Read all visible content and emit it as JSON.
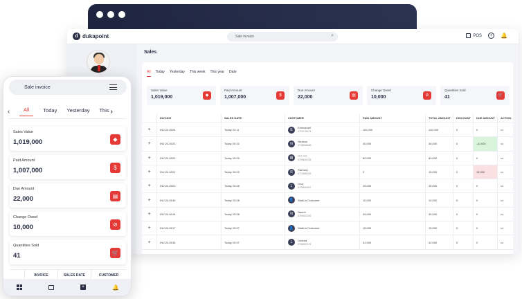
{
  "app": {
    "brand": "dukapoint",
    "logo_letter": "d"
  },
  "topbar": {
    "search_placeholder": "Sale invoice",
    "pos_label": "POS"
  },
  "page": {
    "title": "Sales"
  },
  "tabs": [
    "All",
    "Today",
    "Yesterday",
    "This week",
    "This year",
    "Date"
  ],
  "cards": [
    {
      "label": "Sales Value",
      "value": "1,019,000",
      "icon": "tag-icon"
    },
    {
      "label": "Paid Amount",
      "value": "1,007,000",
      "icon": "money-icon"
    },
    {
      "label": "Due Amount",
      "value": "22,000",
      "icon": "invoice-icon"
    },
    {
      "label": "Change Owed",
      "value": "10,000",
      "icon": "change-icon"
    },
    {
      "label": "Quantities Sold",
      "value": "41",
      "icon": "cart-icon"
    }
  ],
  "table": {
    "headers": [
      "INVOICE",
      "SALES DATE",
      "CUSTOMER",
      "PAID AMOUNT",
      "TOTAL AMOUNT",
      "DISCOUNT",
      "DUE AMOUNT",
      "ACTION"
    ],
    "rows": [
      {
        "invoice": "INV-24-0024",
        "date": "Today 20:11",
        "cust_initial": "E",
        "cust_name": "Emmanuel",
        "cust_phone": "0724741474",
        "paid": "110,000",
        "total": "110,000",
        "discount": "0",
        "due": "0",
        "due_state": ""
      },
      {
        "invoice": "INV-24-0023",
        "date": "Today 20:10",
        "cust_initial": "N",
        "cust_name": "Nickson",
        "cust_phone": "0748506483",
        "paid": "40,000",
        "total": "30,000",
        "discount": "0",
        "due": "-10,000",
        "due_state": "green"
      },
      {
        "invoice": "INV-24-0022",
        "date": "Today 20:09",
        "cust_initial": "▤",
        "cust_name": "**** ****",
        "cust_phone": "0796694235",
        "paid": "80,000",
        "total": "80,000",
        "discount": "0",
        "due": "0",
        "due_state": ""
      },
      {
        "invoice": "INV-24-0021",
        "date": "Today 20:09",
        "cust_initial": "R",
        "cust_name": "Ramsey",
        "cust_phone": "0724656252",
        "paid": "0",
        "total": "15,000",
        "discount": "0",
        "due": "15,000",
        "due_state": "red"
      },
      {
        "invoice": "INV-24-0020",
        "date": "Today 20:08",
        "cust_initial": "L",
        "cust_name": "Lucy",
        "cust_phone": "0746662657",
        "paid": "45,000",
        "total": "45,000",
        "discount": "0",
        "due": "0",
        "due_state": ""
      },
      {
        "invoice": "INV-24-0019",
        "date": "Today 20:08",
        "cust_initial": "👤",
        "cust_name": "Walk-in Customer",
        "cust_phone": "",
        "paid": "10,000",
        "total": "10,000",
        "discount": "0",
        "due": "0",
        "due_state": ""
      },
      {
        "invoice": "INV-24-0018",
        "date": "Today 20:08",
        "cust_initial": "N",
        "cust_name": "Naomi",
        "cust_phone": "0794002292",
        "paid": "35,000",
        "total": "35,000",
        "discount": "0",
        "due": "0",
        "due_state": ""
      },
      {
        "invoice": "INV-24-0017",
        "date": "Today 20:07",
        "cust_initial": "👤",
        "cust_name": "Walk-in Customer",
        "cust_phone": "",
        "paid": "15,000",
        "total": "15,000",
        "discount": "0",
        "due": "0",
        "due_state": ""
      },
      {
        "invoice": "INV-24-0016",
        "date": "Today 20:07",
        "cust_initial": "L",
        "cust_name": "Lubeda",
        "cust_phone": "0756567474",
        "paid": "42,000",
        "total": "42,000",
        "discount": "0",
        "due": "0",
        "due_state": ""
      }
    ]
  },
  "mobile": {
    "search_placeholder": "Sale invoice",
    "tabs": [
      "All",
      "Today",
      "Yesterday",
      "This"
    ],
    "cards": [
      {
        "label": "Sales Value",
        "value": "1,019,000"
      },
      {
        "label": "Paid Amount",
        "value": "1,007,000"
      },
      {
        "label": "Due Amount",
        "value": "22,000"
      },
      {
        "label": "Change Owed",
        "value": "10,000"
      },
      {
        "label": "Quantities Sold",
        "value": "41"
      }
    ],
    "table_headers": [
      "INVOICE",
      "SALES DATE",
      "CUSTOMER"
    ]
  }
}
